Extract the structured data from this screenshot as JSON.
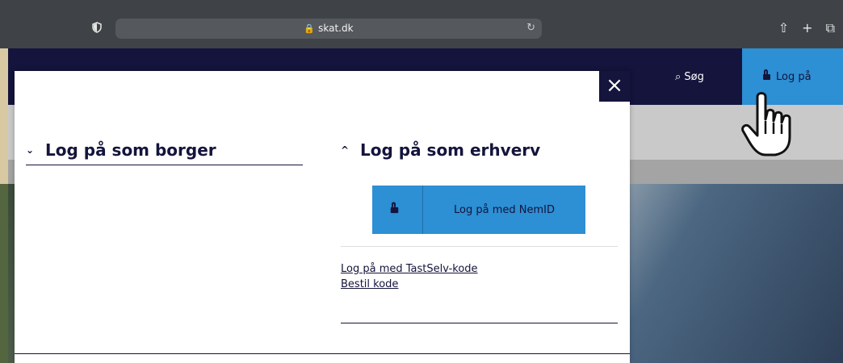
{
  "browser": {
    "url": "skat.dk",
    "shield_icon": "shield-icon",
    "lock_icon": "lock-icon",
    "reload_icon": "reload-icon",
    "share_icon": "share-icon",
    "new_tab_icon": "plus-icon",
    "tabs_icon": "tabs-icon"
  },
  "header": {
    "search_label": "Søg",
    "login_label": "Log på",
    "colors": {
      "navy": "#14143c",
      "blue": "#2d8fd4"
    }
  },
  "modal": {
    "close_glyph": "×",
    "borger": {
      "title": "Log på som borger",
      "expanded": false
    },
    "erhverv": {
      "title": "Log på som erhverv",
      "expanded": true,
      "nemid_button": "Log på med NemID",
      "links": [
        "Log på med TastSelv-kode",
        "Bestil kode"
      ]
    }
  }
}
